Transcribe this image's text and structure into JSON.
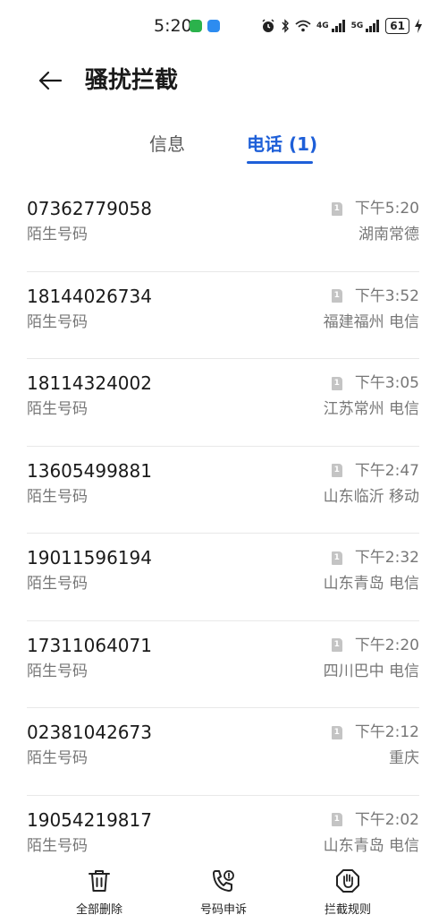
{
  "status_bar": {
    "time": "5:20",
    "network_1": "4G",
    "network_2": "5G",
    "battery": "61"
  },
  "header": {
    "title": "骚扰拦截"
  },
  "tabs": {
    "messages": "信息",
    "calls": "电话 (1)"
  },
  "colors": {
    "accent": "#1e5fd8",
    "secondary_text": "#777777"
  },
  "calls": [
    {
      "number": "07362779058",
      "label": "陌生号码",
      "time": "下午5:20",
      "location": "湖南常德",
      "sim": "1"
    },
    {
      "number": "18144026734",
      "label": "陌生号码",
      "time": "下午3:52",
      "location": "福建福州 电信",
      "sim": "1"
    },
    {
      "number": "18114324002",
      "label": "陌生号码",
      "time": "下午3:05",
      "location": "江苏常州 电信",
      "sim": "1"
    },
    {
      "number": "13605499881",
      "label": "陌生号码",
      "time": "下午2:47",
      "location": "山东临沂 移动",
      "sim": "1"
    },
    {
      "number": "19011596194",
      "label": "陌生号码",
      "time": "下午2:32",
      "location": "山东青岛 电信",
      "sim": "1"
    },
    {
      "number": "17311064071",
      "label": "陌生号码",
      "time": "下午2:20",
      "location": "四川巴中 电信",
      "sim": "1"
    },
    {
      "number": "02381042673",
      "label": "陌生号码",
      "time": "下午2:12",
      "location": "重庆",
      "sim": "1"
    },
    {
      "number": "19054219817",
      "label": "陌生号码",
      "time": "下午2:02",
      "location": "山东青岛 电信",
      "sim": "1"
    }
  ],
  "bottom_bar": {
    "delete_all": "全部删除",
    "number_appeal": "号码申诉",
    "block_rules": "拦截规则"
  }
}
